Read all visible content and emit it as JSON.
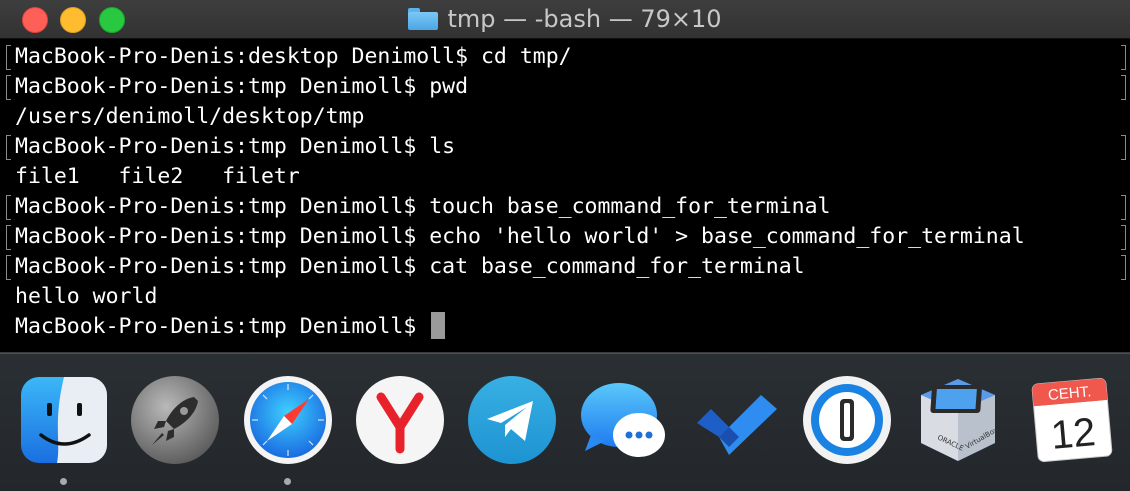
{
  "window": {
    "title": "tmp — -bash — 79×10",
    "folder_icon": "folder-icon"
  },
  "terminal": {
    "lines": [
      {
        "text": "MacBook-Pro-Denis:desktop Denimoll$ cd tmp/",
        "marked": true
      },
      {
        "text": "MacBook-Pro-Denis:tmp Denimoll$ pwd",
        "marked": true
      },
      {
        "text": "/users/denimoll/desktop/tmp",
        "marked": false
      },
      {
        "text": "MacBook-Pro-Denis:tmp Denimoll$ ls",
        "marked": true
      },
      {
        "text": "file1   file2   filetr",
        "marked": false
      },
      {
        "text": "MacBook-Pro-Denis:tmp Denimoll$ touch base_command_for_terminal",
        "marked": true
      },
      {
        "text": "MacBook-Pro-Denis:tmp Denimoll$ echo 'hello world' > base_command_for_terminal",
        "marked": true
      },
      {
        "text": "MacBook-Pro-Denis:tmp Denimoll$ cat base_command_for_terminal",
        "marked": true
      },
      {
        "text": "hello world",
        "marked": false
      }
    ],
    "prompt": "MacBook-Pro-Denis:tmp Denimoll$ "
  },
  "dock": {
    "apps": [
      {
        "name": "finder",
        "icon": "finder-icon",
        "running": true
      },
      {
        "name": "launchpad",
        "icon": "rocket-icon",
        "running": false
      },
      {
        "name": "safari",
        "icon": "compass-icon",
        "running": true
      },
      {
        "name": "yandex-browser",
        "icon": "yandex-icon",
        "running": false
      },
      {
        "name": "telegram",
        "icon": "paper-plane-icon",
        "running": false
      },
      {
        "name": "messages",
        "icon": "chat-bubble-icon",
        "running": false
      },
      {
        "name": "microsoft-todo",
        "icon": "checkmark-icon",
        "running": false
      },
      {
        "name": "1password",
        "icon": "keyhole-icon",
        "running": false
      },
      {
        "name": "virtualbox",
        "icon": "virtualbox-cube-icon",
        "running": false
      },
      {
        "name": "calendar",
        "icon": "calendar-icon",
        "running": false
      }
    ],
    "calendar": {
      "month": "СЕНТ.",
      "day": "12"
    }
  }
}
